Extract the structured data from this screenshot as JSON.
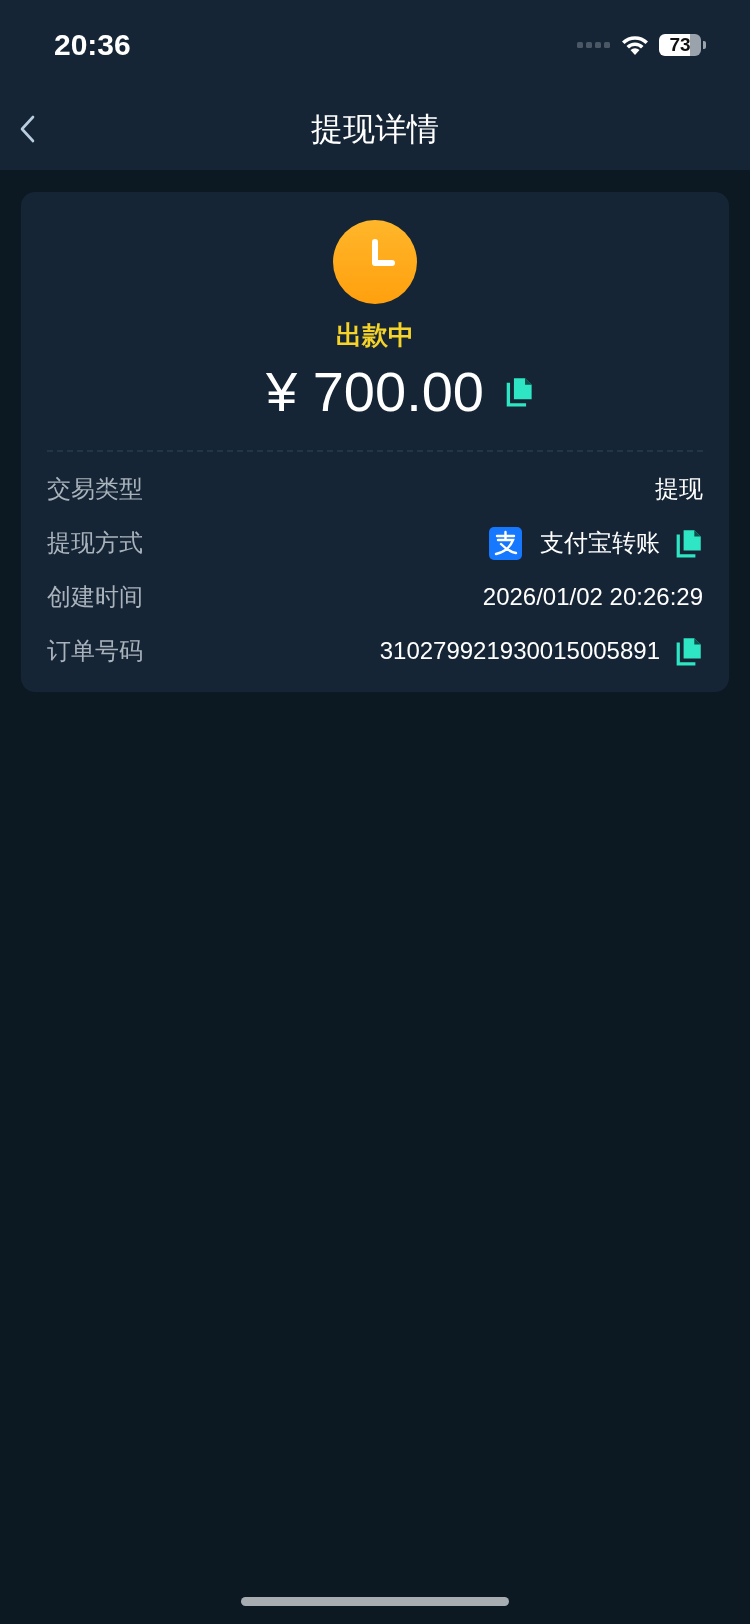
{
  "status_bar": {
    "time": "20:36",
    "battery": "73"
  },
  "nav": {
    "title": "提现详情"
  },
  "summary": {
    "status": "出款中",
    "amount": "¥ 700.00"
  },
  "rows": [
    {
      "kind": "plain",
      "label": "交易类型",
      "value": "提现"
    },
    {
      "kind": "payment",
      "label": "提现方式",
      "value": "支付宝转账"
    },
    {
      "kind": "plain",
      "label": "创建时间",
      "value": "2026/01/02 20:26:29"
    },
    {
      "kind": "copy",
      "label": "订单号码",
      "value": "310279921930015005891"
    }
  ]
}
